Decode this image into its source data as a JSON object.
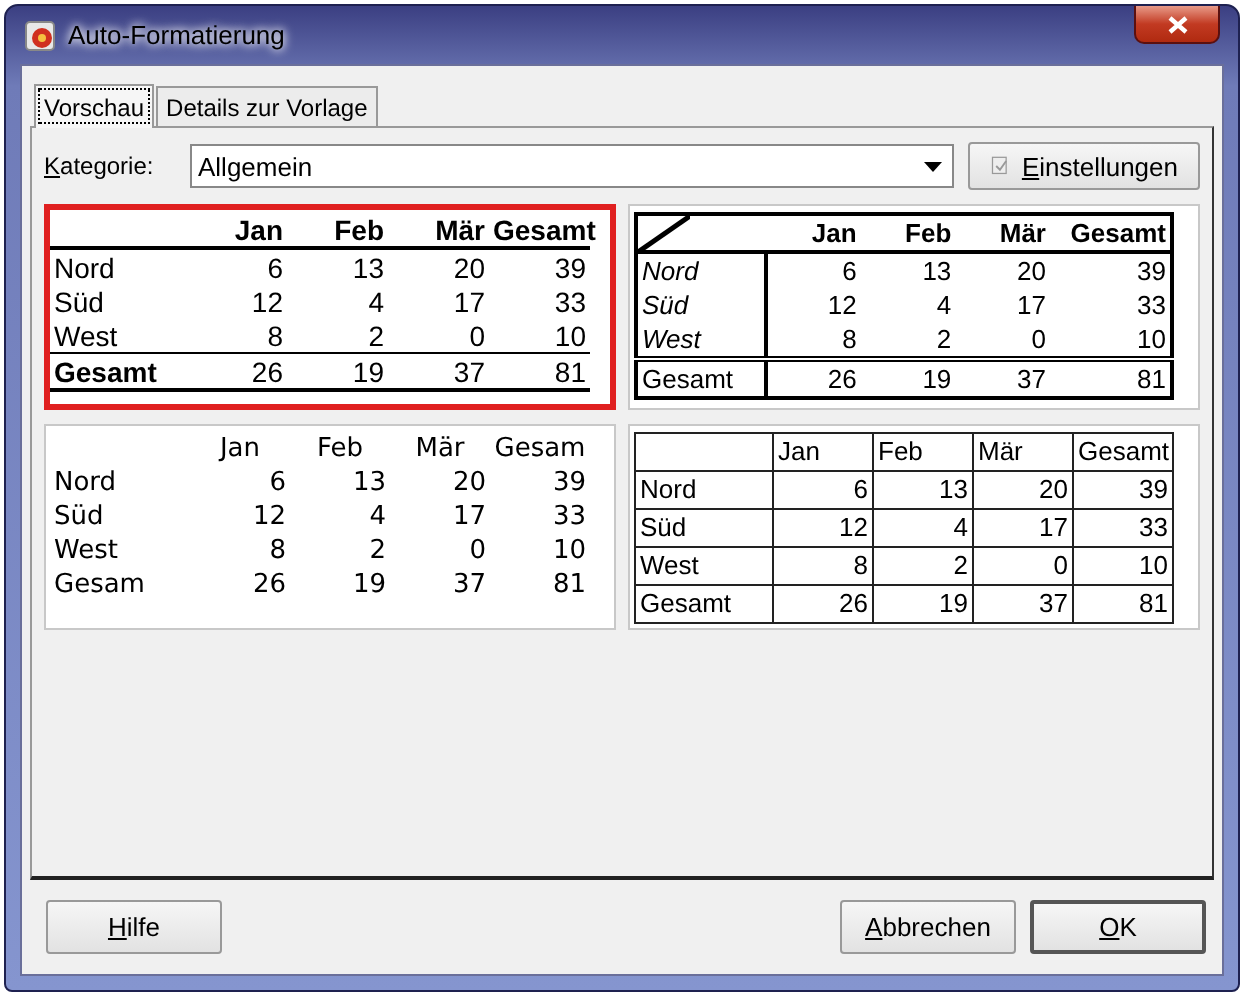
{
  "window": {
    "title": "Auto-Formatierung"
  },
  "tabs": [
    {
      "label": "Vorschau",
      "selected": true
    },
    {
      "label": "Details zur Vorlage",
      "selected": false
    }
  ],
  "category": {
    "label": {
      "mnemonic": "K",
      "rest": "ategorie:"
    },
    "value": "Allgemein"
  },
  "settings_button": {
    "mnemonic": "E",
    "rest": "instellungen"
  },
  "previews": [
    {
      "kind": "bold",
      "selected": true,
      "columns": [
        "Jan",
        "Feb",
        "Mär",
        "Gesamt"
      ],
      "rows": [
        {
          "label": "Nord",
          "cells": [
            "6",
            "13",
            "20",
            "39"
          ]
        },
        {
          "label": "Süd",
          "cells": [
            "12",
            "4",
            "17",
            "33"
          ]
        },
        {
          "label": "West",
          "cells": [
            "8",
            "2",
            "0",
            "10"
          ]
        },
        {
          "label": "Gesamt",
          "cells": [
            "26",
            "19",
            "37",
            "81"
          ]
        }
      ]
    },
    {
      "kind": "box",
      "selected": false,
      "columns": [
        "Jan",
        "Feb",
        "Mär",
        "Gesamt"
      ],
      "rows": [
        {
          "label": "Nord",
          "cells": [
            "6",
            "13",
            "20",
            "39"
          ]
        },
        {
          "label": "Süd",
          "cells": [
            "12",
            "4",
            "17",
            "33"
          ]
        },
        {
          "label": "West",
          "cells": [
            "8",
            "2",
            "0",
            "10"
          ]
        },
        {
          "label": "Gesamt",
          "cells": [
            "26",
            "19",
            "37",
            "81"
          ]
        }
      ]
    },
    {
      "kind": "plain",
      "selected": false,
      "columns": [
        "Jan",
        "Feb",
        "Mär",
        "Gesam"
      ],
      "rows": [
        {
          "label": "Nord",
          "cells": [
            "6",
            "13",
            "20",
            "39"
          ]
        },
        {
          "label": "Süd",
          "cells": [
            "12",
            "4",
            "17",
            "33"
          ]
        },
        {
          "label": "West",
          "cells": [
            "8",
            "2",
            "0",
            "10"
          ]
        },
        {
          "label": "Gesam",
          "cells": [
            "26",
            "19",
            "37",
            "81"
          ]
        }
      ]
    },
    {
      "kind": "grid",
      "selected": false,
      "columns": [
        "Jan",
        "Feb",
        "Mär",
        "Gesamt"
      ],
      "rows": [
        {
          "label": "Nord",
          "cells": [
            "6",
            "13",
            "20",
            "39"
          ]
        },
        {
          "label": "Süd",
          "cells": [
            "12",
            "4",
            "17",
            "33"
          ]
        },
        {
          "label": "West",
          "cells": [
            "8",
            "2",
            "0",
            "10"
          ]
        },
        {
          "label": "Gesamt",
          "cells": [
            "26",
            "19",
            "37",
            "81"
          ]
        }
      ]
    }
  ],
  "buttons": [
    {
      "kind": "help",
      "mnemonic": "H",
      "rest": "ilfe"
    },
    {
      "kind": "cancel",
      "mnemonic": "A",
      "rest": "bbrechen"
    },
    {
      "kind": "ok",
      "mnemonic": "O",
      "rest": "K"
    }
  ]
}
